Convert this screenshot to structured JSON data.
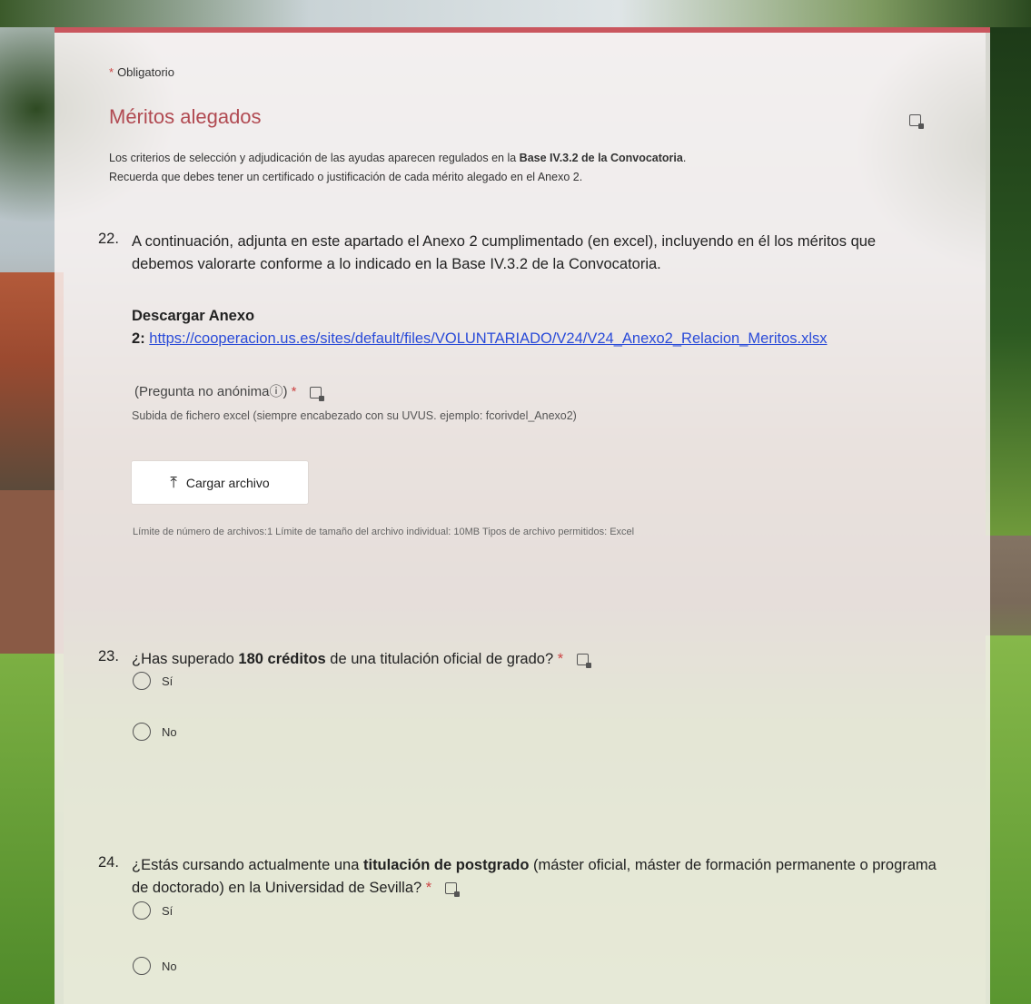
{
  "required_note": "Obligatorio",
  "section": {
    "title": "Méritos alegados",
    "desc_line1_prefix": "Los criterios de selección y adjudicación de las ayudas aparecen regulados en la ",
    "desc_line1_bold": "Base IV.3.2 de la Convocatoria",
    "desc_line1_suffix": ".",
    "desc_line2": "Recuerda que debes tener un certificado o justificación de cada mérito alegado en el Anexo 2."
  },
  "q22": {
    "number": "22.",
    "text": "A continuación, adjunta en este apartado el Anexo 2 cumplimentado (en excel), incluyendo en él los méritos que debemos valorarte conforme a lo indicado en la Base IV.3.2 de la Convocatoria.",
    "download_label": "Descargar Anexo",
    "download_prefix": "2",
    "download_link": "https://cooperacion.us.es/sites/default/files/VOLUNTARIADO/V24/V24_Anexo2_Relacion_Meritos.xlsx",
    "anon_label": "(Pregunta no anónima",
    "anon_info": "ⓘ",
    "anon_close": ")",
    "hint": "Subida de fichero excel (siempre encabezado con su UVUS. ejemplo: fcorivdel_Anexo2)",
    "upload_button": "Cargar archivo",
    "limits": "Límite de número de archivos:1   Límite de tamaño del archivo individual: 10MB   Tipos de archivo permitidos: Excel"
  },
  "q23": {
    "number": "23.",
    "text_prefix": "¿Has superado ",
    "text_bold": "180 créditos",
    "text_suffix": " de una titulación oficial de grado?",
    "options": [
      "Sí",
      "No"
    ]
  },
  "q24": {
    "number": "24.",
    "text_prefix": "¿Estás cursando actualmente una ",
    "text_bold": "titulación de postgrado",
    "text_suffix": " (máster oficial, máster de formación permanente o programa de doctorado) en la Universidad de Sevilla?",
    "options": [
      "Sí",
      "No"
    ]
  },
  "required_star": "*",
  "colors": {
    "accent": "#c9565e",
    "title": "#b14a52",
    "link": "#2a4bd8"
  }
}
